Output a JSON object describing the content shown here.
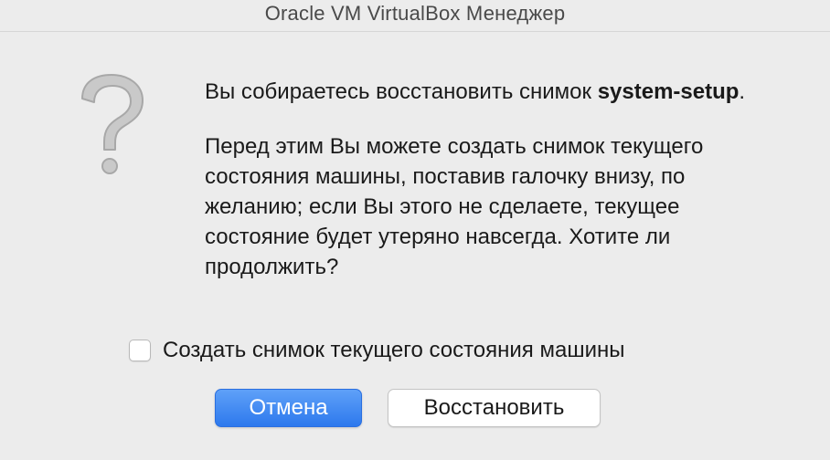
{
  "window": {
    "title": "Oracle VM VirtualBox Менеджер"
  },
  "dialog": {
    "icon": "question-icon",
    "message_line1_prefix": "Вы собираетесь восстановить снимок ",
    "snapshot_name": "system-setup",
    "message_line1_suffix": ".",
    "message_line2": "Перед этим Вы можете создать снимок текущего состояния машины, поставив галочку внизу, по желанию; если Вы этого не сделаете, текущее состояние будет утеряно навсегда. Хотите ли продолжить?",
    "checkbox": {
      "label": "Создать снимок текущего состояния машины",
      "checked": false
    },
    "buttons": {
      "cancel_label": "Отмена",
      "restore_label": "Восстановить"
    }
  },
  "colors": {
    "window_bg": "#ececec",
    "default_button": "#2d79ed",
    "icon_gray": "#b3b3b3"
  }
}
